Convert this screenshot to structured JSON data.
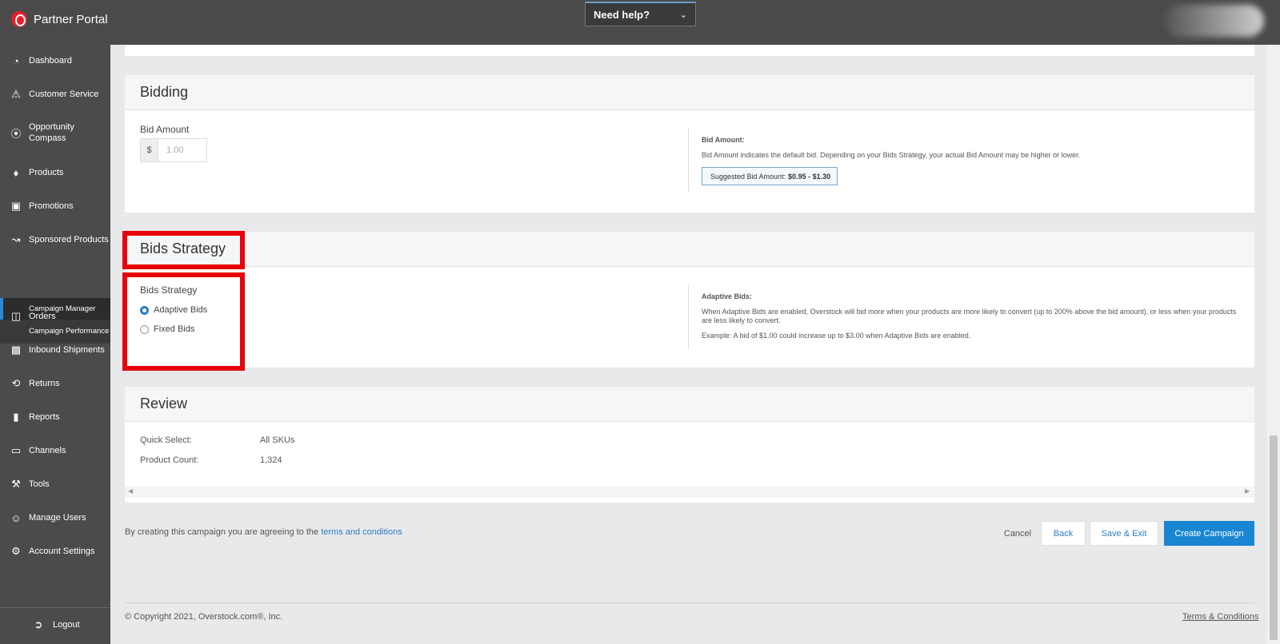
{
  "app": {
    "title": "Partner Portal"
  },
  "help": {
    "label": "Need help?"
  },
  "sidebar": {
    "items": [
      {
        "label": "Dashboard",
        "icon": "dashboard-icon"
      },
      {
        "label": "Customer Service",
        "icon": "warning-icon"
      },
      {
        "label": "Opportunity Compass",
        "icon": "compass-icon"
      },
      {
        "label": "Products",
        "icon": "tag-icon"
      },
      {
        "label": "Promotions",
        "icon": "money-icon"
      },
      {
        "label": "Sponsored Products",
        "icon": "line-chart-icon"
      },
      {
        "label": "Orders",
        "icon": "inbox-icon"
      },
      {
        "label": "Inbound Shipments",
        "icon": "truck-icon"
      },
      {
        "label": "Returns",
        "icon": "return-icon"
      },
      {
        "label": "Reports",
        "icon": "bar-chart-icon"
      },
      {
        "label": "Channels",
        "icon": "monitor-icon"
      },
      {
        "label": "Tools",
        "icon": "wrench-icon"
      },
      {
        "label": "Manage Users",
        "icon": "users-icon"
      },
      {
        "label": "Account Settings",
        "icon": "gear-icon"
      }
    ],
    "subitems": [
      {
        "label": "Campaign Manager",
        "active": true
      },
      {
        "label": "Campaign Performance",
        "active": false
      }
    ],
    "logout": "Logout"
  },
  "bidding": {
    "title": "Bidding",
    "bid_amount_label": "Bid Amount",
    "currency": "$",
    "bid_placeholder": "1.00",
    "info_title": "Bid Amount:",
    "info_text": "Bid Amount indicates the default bid. Depending on your Bids Strategy, your actual Bid Amount may be higher or lower.",
    "suggested_prefix": "Suggested Bid Amount:",
    "suggested_range": "$0.95 - $1.30"
  },
  "strategy": {
    "title": "Bids Strategy",
    "label": "Bids Strategy",
    "options": [
      {
        "label": "Adaptive Bids",
        "selected": true
      },
      {
        "label": "Fixed Bids",
        "selected": false
      }
    ],
    "info_title": "Adaptive Bids:",
    "info_text": "When Adaptive Bids are enabled, Overstock will bid more when your products are more likely to convert (up to 200% above the bid amount), or less when your products are less likely to convert.",
    "example": "Example: A bid of $1.00 could increase up to $3.00 when Adaptive Bids are enabled."
  },
  "review": {
    "title": "Review",
    "rows": [
      {
        "key": "Quick Select:",
        "value": "All SKUs"
      },
      {
        "key": "Product Count:",
        "value": "1,324"
      }
    ]
  },
  "footer": {
    "agree_text": "By creating this campaign you are agreeing to the",
    "terms_link": "terms and conditions",
    "cancel": "Cancel",
    "back": "Back",
    "save_exit": "Save & Exit",
    "create": "Create Campaign",
    "copyright": "© Copyright 2021, Overstock.com®, Inc.",
    "terms": "Terms & Conditions"
  },
  "colors": {
    "accent": "#1a85d3",
    "highlight": "#e8000b",
    "sidebar": "#4b4b4b"
  }
}
